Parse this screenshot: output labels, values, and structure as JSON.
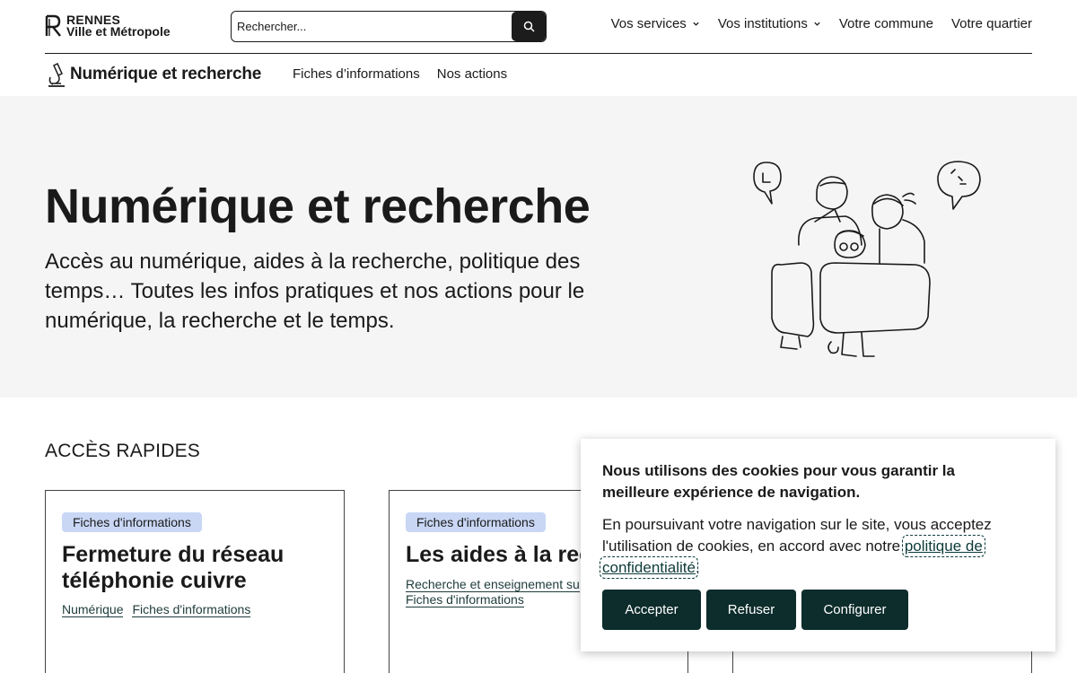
{
  "header": {
    "logo_line1": "RENNES",
    "logo_line2": "Ville et Métropole",
    "search_placeholder": "Rechercher...",
    "nav": [
      {
        "label": "Vos services",
        "has_menu": true
      },
      {
        "label": "Vos institutions",
        "has_menu": true
      },
      {
        "label": "Votre commune",
        "has_menu": false
      },
      {
        "label": "Votre quartier",
        "has_menu": false
      }
    ]
  },
  "subheader": {
    "title": "Numérique et recherche",
    "nav": [
      "Fiches d’informations",
      "Nos actions"
    ]
  },
  "hero": {
    "title": "Numérique et recherche",
    "description": "Accès au numérique, aides à la recherche, politique des temps… Toutes les infos pratiques et nos actions pour le numérique, la recherche et le temps."
  },
  "quick_access": {
    "title": "ACCÈS RAPIDES",
    "cards": [
      {
        "badge": "Fiches d'informations",
        "title": "Fermeture du réseau téléphonie cuivre",
        "tags": [
          "Numérique",
          "Fiches d'informations"
        ]
      },
      {
        "badge": "Fiches d'informations",
        "title": "Les aides à la rech",
        "tags": [
          "Recherche et enseignement su",
          "Fiches d'informations"
        ]
      }
    ]
  },
  "cookie": {
    "heading": "Nous utilisons des cookies pour vous garantir la meilleure expérience de navigation.",
    "body_before": "En poursuivant votre navigation sur le site, vous acceptez l'utilisation de cookies, en accord avec notre ",
    "link": "politique de confidentialité",
    "body_after": ".",
    "buttons": {
      "accept": "Accepter",
      "refuse": "Refuser",
      "configure": "Configurer"
    }
  },
  "colors": {
    "button_dark": "#0d2c2c",
    "badge_bg": "#c9d7f5",
    "hero_bg": "#f5f5f5",
    "link": "#1e3b3a"
  }
}
